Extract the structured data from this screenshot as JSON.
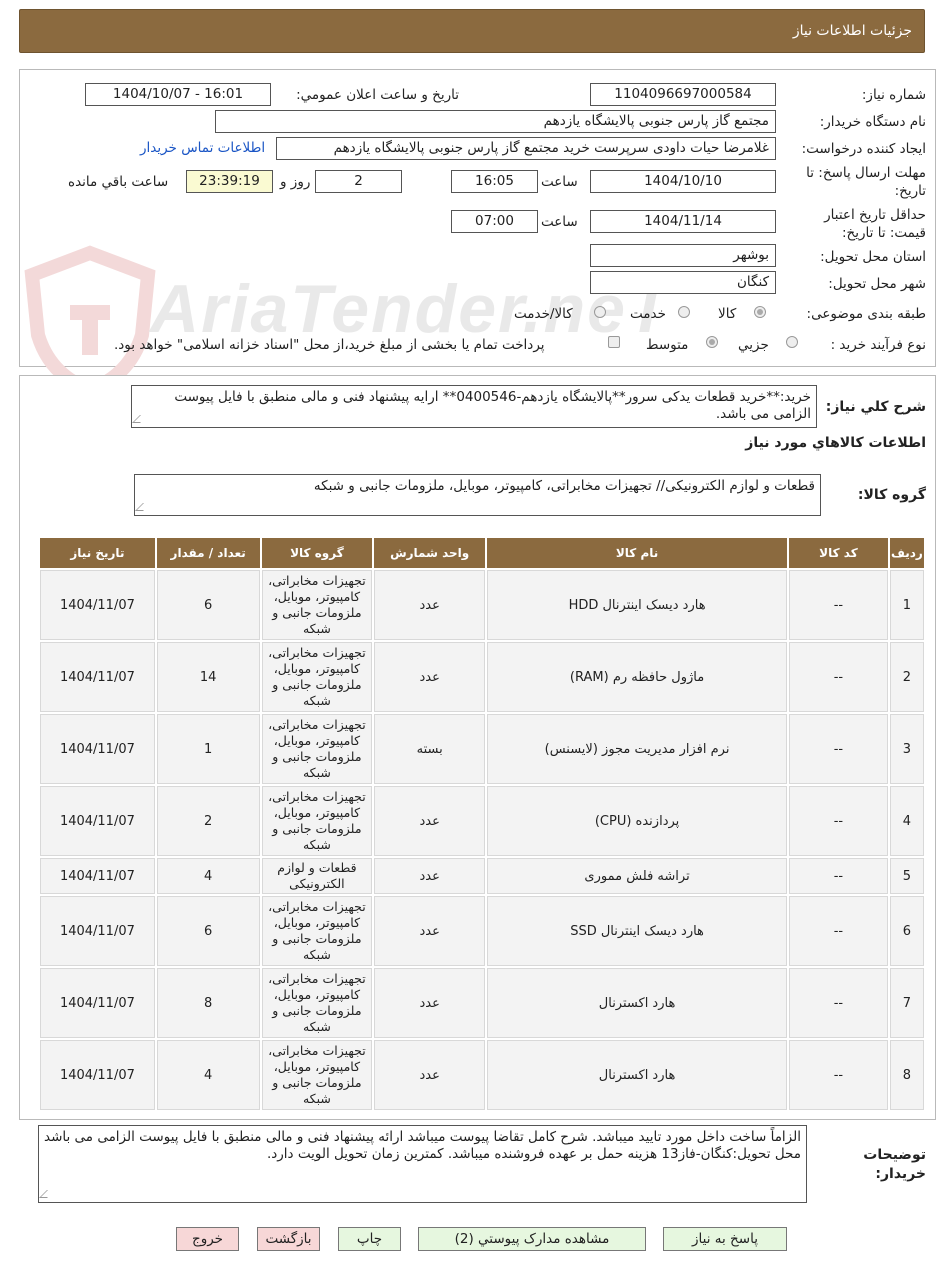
{
  "page_title": "جزئیات اطلاعات نیاز",
  "watermark": "AriaTender.neT",
  "fields": {
    "need_number_label": "شماره نیاز:",
    "need_number": "1104096697000584",
    "announce_label": "تاریخ و ساعت اعلان عمومي:",
    "announce_value": "1404/10/07 - 16:01",
    "buyer_label": "نام دستگاه خریدار:",
    "buyer_value": "مجتمع گاز پارس جنوبی  پالایشگاه یازدهم",
    "creator_label": "ایجاد کننده درخواست:",
    "creator_value": "غلامرضا حیات داودی سرپرست خرید مجتمع گاز پارس جنوبی  پالایشگاه یازدهم",
    "contact_link": "اطلاعات تماس خریدار",
    "deadline_label": "مهلت ارسال پاسخ: تا تاریخ:",
    "deadline_date": "1404/10/10",
    "time_label": "ساعت",
    "deadline_time": "16:05",
    "days_value": "2",
    "days_label": "روز و",
    "remaining_time": "23:39:19",
    "remaining_label": "ساعت باقي مانده",
    "validity_label": "حداقل تاریخ اعتبار قیمت: تا تاریخ:",
    "validity_date": "1404/11/14",
    "validity_time_label": "ساعت",
    "validity_time": "07:00",
    "province_label": "استان محل تحویل:",
    "province_value": "بوشهر",
    "city_label": "شهر محل تحویل:",
    "city_value": "کنگان",
    "category_label": "طبقه بندی موضوعی:",
    "category_options": [
      "کالا",
      "خدمت",
      "کالا/خدمت"
    ],
    "process_label": "نوع فرآیند خرید :",
    "process_options": [
      "جزیي",
      "متوسط"
    ],
    "process_note": "پرداخت تمام یا بخشی از مبلغ خرید،از محل \"اسناد خزانه اسلامی\" خواهد بود."
  },
  "description": {
    "label": "شرح کلي نیاز:",
    "value": "خرید:**خرید قطعات یدکی سرور**پالایشگاه یازدهم-0400546** ارایه پیشنهاد فنی و مالی منطبق با فایل پیوست الزامی می باشد."
  },
  "goods_section_title": "اطلاعات کالاهاي مورد نیاز",
  "goods_group": {
    "label": "گروه کالا:",
    "value": "قطعات و لوازم الکترونیکی// تجهیزات مخابراتی، کامپیوتر، موبایل، ملزومات جانبی و شبکه"
  },
  "table": {
    "headers": [
      "ردیف",
      "کد کالا",
      "نام کالا",
      "واحد شمارش",
      "گروه کالا",
      "تعداد / مقدار",
      "تاریخ نیاز"
    ],
    "rows": [
      {
        "row": "1",
        "code": "--",
        "name": "هارد دیسک اینترنال HDD",
        "unit": "عدد",
        "group": "تجهیزات مخابراتی، کامپیوتر، موبایل، ملزومات جانبی و شبکه",
        "qty": "6",
        "date": "1404/11/07"
      },
      {
        "row": "2",
        "code": "--",
        "name": "ماژول حافظه رم (RAM)",
        "unit": "عدد",
        "group": "تجهیزات مخابراتی، کامپیوتر، موبایل، ملزومات جانبی و شبکه",
        "qty": "14",
        "date": "1404/11/07"
      },
      {
        "row": "3",
        "code": "--",
        "name": "نرم افزار مدیریت مجوز (لایسنس)",
        "unit": "بسته",
        "group": "تجهیزات مخابراتی، کامپیوتر، موبایل، ملزومات جانبی و شبکه",
        "qty": "1",
        "date": "1404/11/07"
      },
      {
        "row": "4",
        "code": "--",
        "name": "پردازنده (CPU)",
        "unit": "عدد",
        "group": "تجهیزات مخابراتی، کامپیوتر، موبایل، ملزومات جانبی و شبکه",
        "qty": "2",
        "date": "1404/11/07"
      },
      {
        "row": "5",
        "code": "--",
        "name": "تراشه فلش مموری",
        "unit": "عدد",
        "group": "قطعات و لوازم الکترونیکی",
        "qty": "4",
        "date": "1404/11/07"
      },
      {
        "row": "6",
        "code": "--",
        "name": "هارد دیسک اینترنال SSD",
        "unit": "عدد",
        "group": "تجهیزات مخابراتی، کامپیوتر، موبایل، ملزومات جانبی و شبکه",
        "qty": "6",
        "date": "1404/11/07"
      },
      {
        "row": "7",
        "code": "--",
        "name": "هارد اکسترنال",
        "unit": "عدد",
        "group": "تجهیزات مخابراتی، کامپیوتر، موبایل، ملزومات جانبی و شبکه",
        "qty": "8",
        "date": "1404/11/07"
      },
      {
        "row": "8",
        "code": "--",
        "name": "هارد اکسترنال",
        "unit": "عدد",
        "group": "تجهیزات مخابراتی، کامپیوتر، موبایل، ملزومات جانبی و شبکه",
        "qty": "4",
        "date": "1404/11/07"
      }
    ]
  },
  "buyer_notes": {
    "label": "توضیحات خریدار:",
    "value": "الزاماً ساخت داخل مورد تایید میباشد. شرح کامل تقاضا پیوست میباشد ارائه پیشنهاد فنی و مالی منطبق با فایل پیوست الزامی می باشد محل تحویل:کنگان-فاز13 هزینه حمل بر عهده فروشنده میباشد. کمترین زمان تحویل الویت دارد."
  },
  "buttons": {
    "reply": "پاسخ به نیاز",
    "attachments": "مشاهده مدارک پیوستي (2)",
    "print": "چاپ",
    "back": "بازگشت",
    "exit": "خروج"
  },
  "colors": {
    "header_brown": "#8b6a3f",
    "green_button": "#e6f7df",
    "red_button": "#f7d7d7",
    "remaining_yellow": "#fafad2",
    "link_blue": "#1a55c5"
  }
}
